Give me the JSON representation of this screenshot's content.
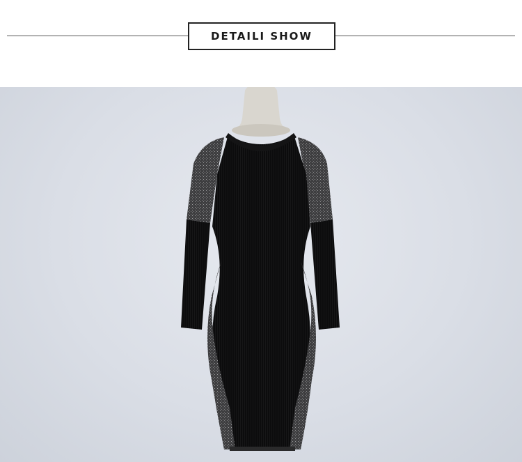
{
  "header": {
    "title": "DETAILI SHOW"
  },
  "product_photo": {
    "subject": "dress-on-mannequin",
    "colors": {
      "background": "#dadee6",
      "dress": "#0b0b0c",
      "sparkle_panel": "#4a4a4c",
      "mannequin": "#d9d6cf"
    }
  }
}
